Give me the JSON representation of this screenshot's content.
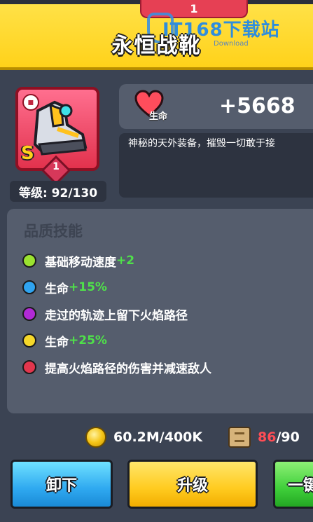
{
  "header": {
    "tab_number": "1",
    "title": "永恒战靴",
    "watermark_brand": "IT168下载站",
    "watermark_sub": "Download"
  },
  "item": {
    "rarity_tag": "S",
    "badge_number": "1",
    "level_text": "等级: 92/130"
  },
  "stat": {
    "label": "生命",
    "value": "+5668",
    "icon": "heart-icon"
  },
  "description": "神秘的天外装备，摧毁一切敢于接",
  "skills": {
    "title": "品质技能",
    "items": [
      {
        "text": "基础移动速度",
        "bonus": "+2",
        "color": "#9be330"
      },
      {
        "text": "生命",
        "bonus": "+15%",
        "color": "#2fa3f0"
      },
      {
        "text": "走过的轨迹上留下火焰路径",
        "bonus": "",
        "color": "#b12ad6"
      },
      {
        "text": "生命",
        "bonus": "+25%",
        "color": "#f6d82a"
      },
      {
        "text": "提高火焰路径的伤害并减速敌人",
        "bonus": "",
        "color": "#e2364d"
      }
    ]
  },
  "resources": {
    "coins": "60.2M/400K",
    "scroll_have": "86",
    "scroll_need": "/90"
  },
  "buttons": {
    "unequip": "卸下",
    "upgrade": "升级",
    "one_click": "一键"
  },
  "colors": {
    "header_yellow": "#ffd21a",
    "card_red": "#e2324d",
    "bonus_green": "#4fe04a",
    "warning_red": "#ff4d55"
  }
}
